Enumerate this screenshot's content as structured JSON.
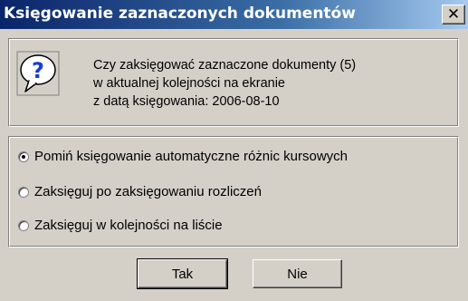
{
  "window": {
    "title": "Księgowanie zaznaczonych dokumentów",
    "close_label": "✕"
  },
  "message": {
    "icon": "question-icon",
    "lines": [
      "Czy zaksięgować zaznaczone dokumenty (5)",
      "w aktualnej kolejności na ekranie",
      "z datą księgowania: 2006-08-10"
    ]
  },
  "options": {
    "selected_index": 0,
    "items": [
      {
        "label": "Pomiń księgowanie automatyczne różnic kursowych"
      },
      {
        "label": "Zaksięguj po zaksięgowaniu rozliczeń"
      },
      {
        "label": "Zaksięguj w kolejności na liście"
      }
    ]
  },
  "buttons": {
    "yes_label": "Tak",
    "no_label": "Nie"
  }
}
